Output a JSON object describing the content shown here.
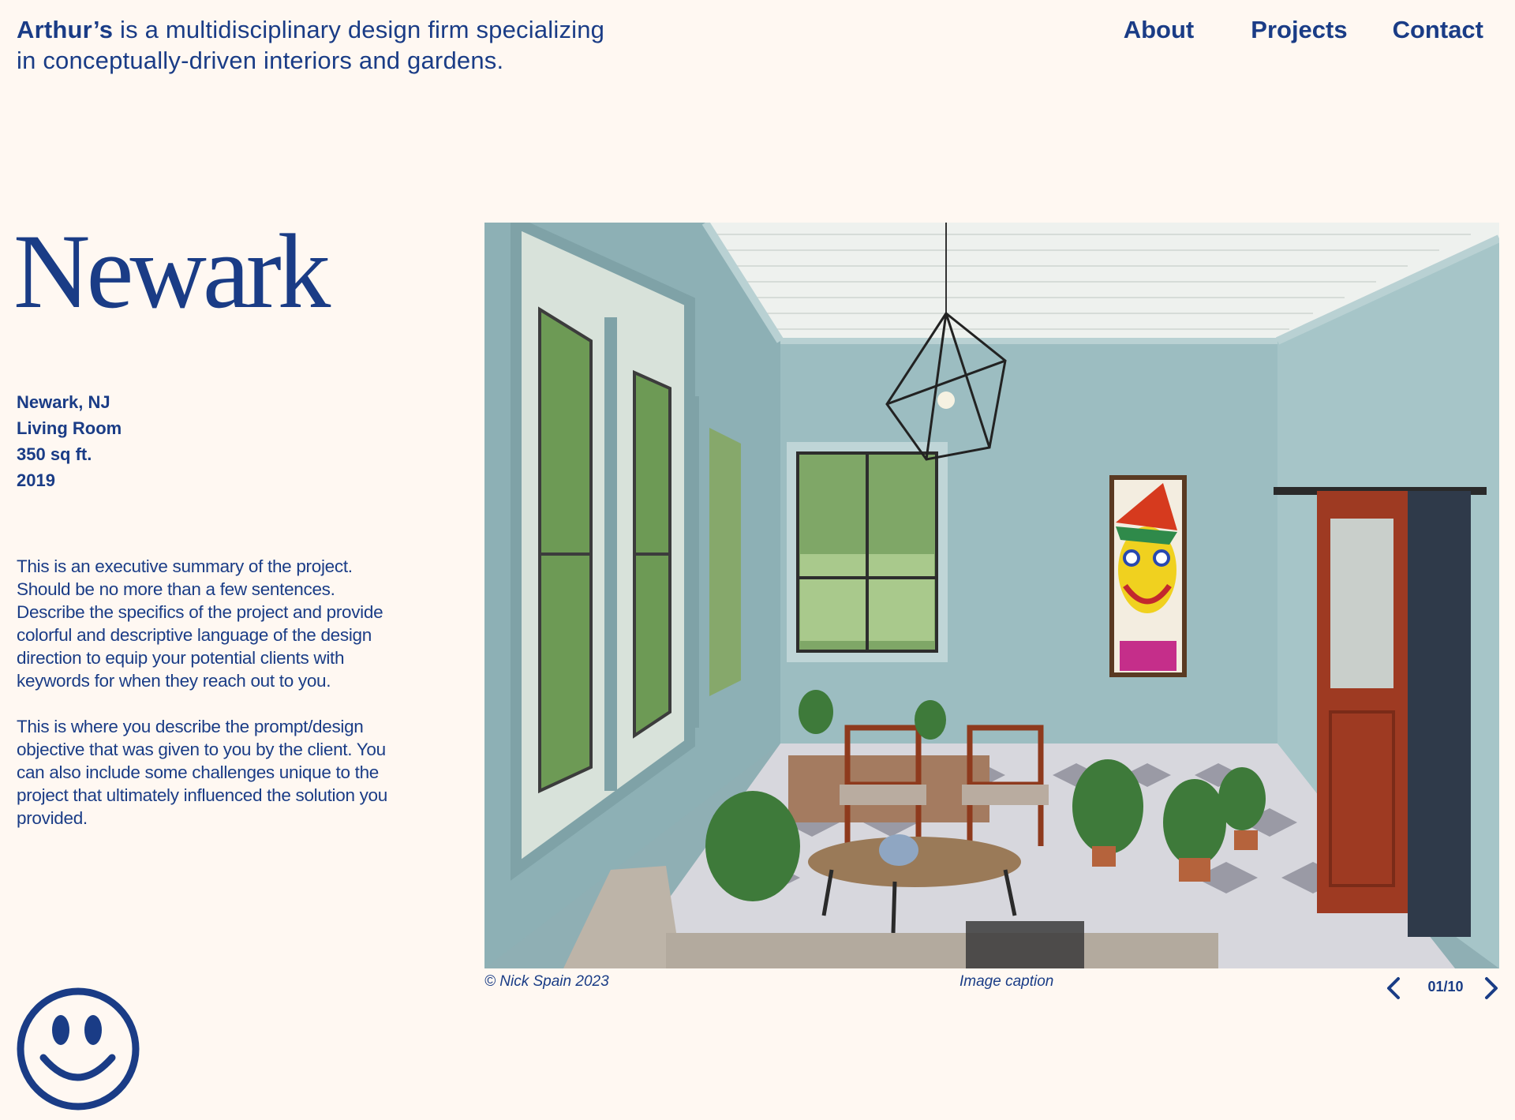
{
  "header": {
    "brand": "Arthur’s",
    "tagline_line1": " is a multidisciplinary design firm specializing",
    "tagline_line2": "in conceptually-driven interiors and gardens."
  },
  "nav": {
    "about": "About",
    "projects": "Projects",
    "contact": "Contact"
  },
  "project": {
    "title": "Newark",
    "location": "Newark, NJ",
    "room": "Living Room",
    "size": "350 sq ft.",
    "year": "2019",
    "summary_p1": "This is an executive summary of the project. Should be no more than a few sentences. Describe the specifics of the project and provide colorful and descriptive language of the design direction to equip your potential clients with keywords for when they reach out to you.",
    "summary_p2": "This is where you describe the prompt/design objective that was given to you by the client. You can also include some challenges unique to the project that ultimately influenced the solution you provided."
  },
  "gallery": {
    "credit": "© Nick Spain 2023",
    "caption": "Image caption",
    "counter": "01/10",
    "image_subject": "living room with pale blue walls, tall windows, red sliding barn door, wooden chairs, potted plants and a colorful face painting"
  },
  "icons": {
    "prev": "chevron-left-icon",
    "next": "chevron-right-icon",
    "logo": "smiley-face-icon"
  },
  "colors": {
    "background": "#FFF8F2",
    "text": "#1A3C86"
  }
}
